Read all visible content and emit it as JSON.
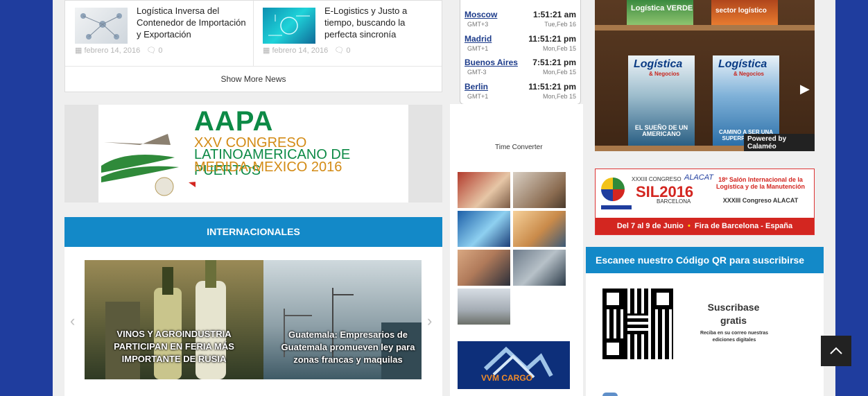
{
  "news": {
    "items": [
      {
        "title": "Logística Inversa del Contenedor de Importación y Exportación",
        "date": "febrero 14, 2016",
        "comments": "0"
      },
      {
        "title": "E-Logistics y Justo a tiempo, buscando la perfecta sincronía",
        "date": "febrero 14, 2016",
        "comments": "0"
      }
    ],
    "show_more": "Show More News"
  },
  "aapa_banner": {
    "acronym": "AAPA",
    "line1": "XXV CONGRESO",
    "line2": "LATINOAMERICANO DE PUERTOS",
    "line3": "MERIDA-MEXICO 2016"
  },
  "internacionales": {
    "header": "INTERNACIONALES",
    "slides": [
      {
        "caption": "VINOS Y AGROINDUSTRIA PARTICIPAN EN FERIA MÁS IMPORTANTE DE RUSIA"
      },
      {
        "caption": "Guatemala: Empresarios de Guatemala promueven ley para zonas francas y maquilas"
      }
    ]
  },
  "world_clock": {
    "rows": [
      {
        "city": "Moscow",
        "gmt": "GMT+3",
        "time": "1:51:21 am",
        "date": "Tue,Feb 16"
      },
      {
        "city": "Madrid",
        "gmt": "GMT+1",
        "time": "11:51:21 pm",
        "date": "Mon,Feb 15"
      },
      {
        "city": "Buenos Aires",
        "gmt": "GMT-3",
        "time": "7:51:21 pm",
        "date": "Mon,Feb 15"
      },
      {
        "city": "Berlin",
        "gmt": "GMT+1",
        "time": "11:51:21 pm",
        "date": "Mon,Feb 15"
      }
    ],
    "converter_label": "Time Converter"
  },
  "vvm_ad": {
    "text": "VVM CARGO"
  },
  "calameo": {
    "shelf_top_left": "Logística VERDE",
    "shelf_top_right": "sector logístico",
    "mag1_title": "Logística",
    "mag1_sub": "& Negocios",
    "mag1_head": "EL SUEÑO DE UN AMERICANO",
    "mag2_title": "Logística",
    "mag2_sub": "& Negocios",
    "mag2_head": "CAMINO A SER UNA SUPERPOTENCIA",
    "powered": "Powered by Calaméo"
  },
  "sil_banner": {
    "top_left": "XXXIII CONGRESO",
    "alacat": "ALACAT",
    "brand": "SIL2016",
    "city": "BARCELONA",
    "salon": "18º Salón Internacional de la Logística y de la Manutención",
    "congreso": "XXXIII Congreso ALACAT",
    "dates": "Del 7 al 9 de Junio",
    "venue": "Fira de Barcelona - España"
  },
  "qr_section": {
    "header": "Escanee nuestro Código QR para suscribirse",
    "title": "Suscribase gratis",
    "subtitle": "Reciba en su correo nuestras ediciones digitales"
  },
  "colors": {
    "accent": "#1389c8",
    "background": "#1f3d9e"
  }
}
